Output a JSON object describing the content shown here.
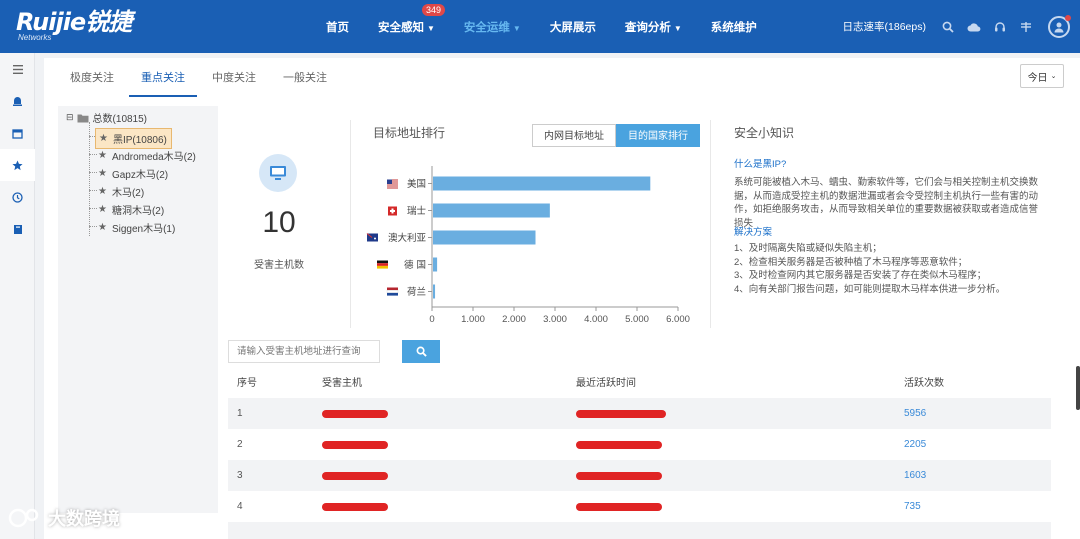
{
  "header": {
    "brand": "Ruijie锐捷",
    "brand_sub": "Networks",
    "nav": [
      {
        "label": "首页"
      },
      {
        "label": "安全感知",
        "badge": "349",
        "caret": true
      },
      {
        "label": "安全运维",
        "caret": true,
        "active": true
      },
      {
        "label": "大屏展示"
      },
      {
        "label": "查询分析",
        "caret": true
      },
      {
        "label": "系统维护"
      }
    ],
    "log_rate": "日志速率(186eps)",
    "icons": [
      "search-icon",
      "cloud-icon",
      "headset-icon",
      "settings-icon",
      "user-avatar-icon"
    ]
  },
  "rail": [
    "menu-icon",
    "alarm-icon",
    "calendar-icon",
    "star-icon",
    "clock-icon",
    "book-icon"
  ],
  "tabs": [
    {
      "label": "极度关注"
    },
    {
      "label": "重点关注",
      "active": true
    },
    {
      "label": "中度关注"
    },
    {
      "label": "一般关注"
    }
  ],
  "date_select": "今日",
  "tree": {
    "root": "总数(10815)",
    "nodes": [
      "黑IP(10806)",
      "Andromeda木马(2)",
      "Gapz木马(2)",
      "木马(2)",
      "糖洞木马(2)",
      "Siggen木马(1)"
    ]
  },
  "stat": {
    "value": "10",
    "label": "受害主机数"
  },
  "chart_panel": {
    "title": "目标地址排行",
    "buttons": [
      {
        "label": "内网目标地址"
      },
      {
        "label": "目的国家排行",
        "active": true
      }
    ]
  },
  "chart_data": {
    "type": "bar",
    "orientation": "horizontal",
    "categories": [
      "美国",
      "瑞士",
      "澳大利亚",
      "德 国",
      "荷兰"
    ],
    "values": [
      5300,
      2850,
      2500,
      100,
      50
    ],
    "xlim": [
      0,
      6000
    ],
    "xticks": [
      "0",
      "1,000",
      "2,000",
      "3,000",
      "4,000",
      "5,000",
      "6,000"
    ],
    "flags": [
      "us-flag-icon",
      "switzerland-flag-icon",
      "australia-flag-icon",
      "germany-flag-icon",
      "netherlands-flag-icon"
    ],
    "bar_color": "#6aaee0"
  },
  "tips": {
    "title": "安全小知识",
    "question": "什么是黑IP?",
    "body": "系统可能被植入木马、蠕虫、勤索软件等，它们会与相关控制主机交换数据，从而造成受控主机的数据泄漏或者会令受控制主机执行一些有害的动作，如拒绝服务攻击，从而导致相关单位的重要数据被获取或者造成信誉损失",
    "solution_title": "解决方案",
    "solutions": [
      "1、及时隔离失陷或疑似失陷主机；",
      "2、检查相关服务器是否被种植了木马程序等恶意软件；",
      "3、及时检查网内其它服务器是否安装了存在类似木马程序；",
      "4、向有关部门报告问题，如可能则提取木马样本供进一步分析。"
    ]
  },
  "search": {
    "placeholder": "请输入受害主机地址进行查询"
  },
  "table": {
    "headers": [
      "序号",
      "受害主机",
      "最近活跃时间",
      "活跃次数"
    ],
    "rows": [
      {
        "no": "1",
        "count": "5956"
      },
      {
        "no": "2",
        "count": "2205"
      },
      {
        "no": "3",
        "count": "1603"
      },
      {
        "no": "4",
        "count": "735"
      }
    ]
  },
  "watermark": "大数跨境"
}
